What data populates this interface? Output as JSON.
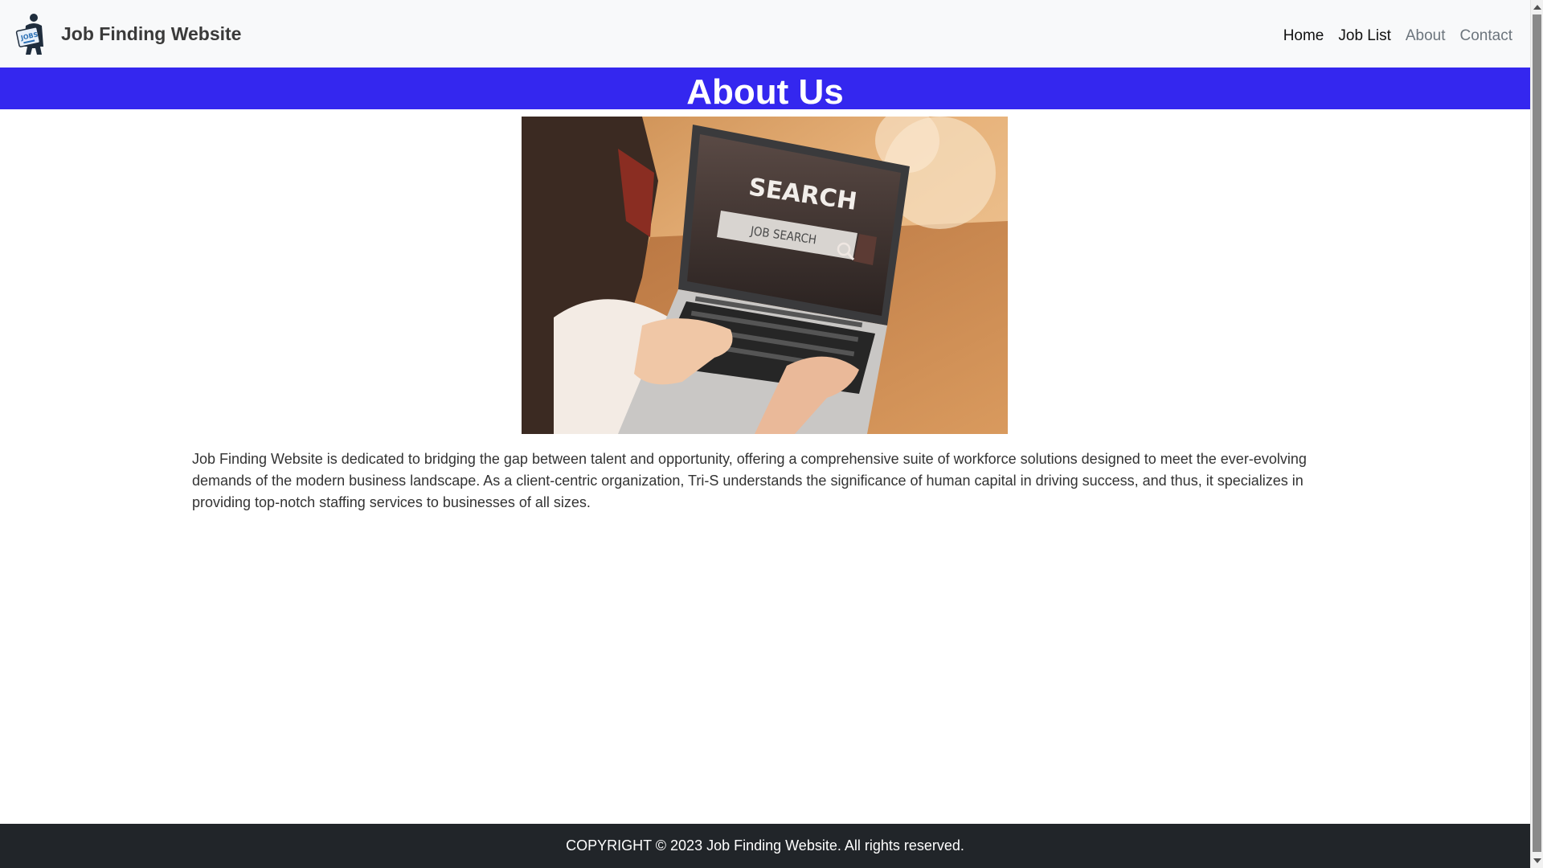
{
  "navbar": {
    "brand_name": "Job Finding Website",
    "logo_icon": "jobs-logo-icon",
    "links": [
      {
        "label": "Home"
      },
      {
        "label": "Job List"
      },
      {
        "label": "About"
      },
      {
        "label": "Contact"
      }
    ]
  },
  "hero": {
    "title": "About Us",
    "background": "#3427ef"
  },
  "photo": {
    "screen_heading": "SEARCH",
    "search_box_text": "JOB SEARCH",
    "search_icon": "magnifier-icon"
  },
  "about": {
    "text": "Job Finding Website is dedicated to bridging the gap between talent and opportunity, offering a comprehensive suite of workforce solutions designed to meet the ever-evolving demands of the modern business landscape. As a client-centric organization, Tri-S understands the significance of human capital in driving success, and thus, it specializes in providing top-notch staffing services to businesses of all sizes."
  },
  "footer": {
    "text": "COPYRIGHT © 2023 Job Finding Website. All rights reserved.",
    "background": "#212529"
  }
}
